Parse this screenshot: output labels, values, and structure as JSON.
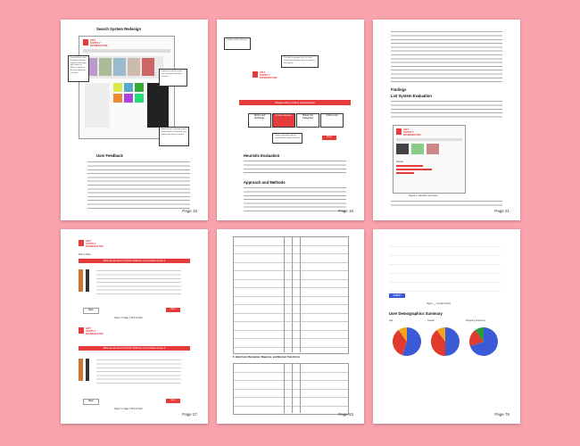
{
  "pages": [
    {
      "number": "Page 15",
      "title": "Search System Redesign",
      "section": "User Feedback",
      "callouts": [
        "Search Bar is now located at the top center of the page with same as above sentences for all, to the user can find",
        "Layout of search results are horizontal instead of vertical",
        "Most critical / relevant action feature that will help the user refine their search results"
      ]
    },
    {
      "number": "Page 16",
      "section1": "Heuristic Evaluation",
      "section2": "Approach and Methods",
      "banner": "Please add a email to unsubscribed",
      "flow_nodes": [
        "Pick-Up Store",
        "Return and Exchange",
        "Product Reviews",
        "Brand and Categories",
        "Artists Look",
        "Back",
        "Next"
      ],
      "flow_callouts": [
        "Visitors visible click box.",
        "Possible to program the list of the store based on the user's location in the system",
        "Option should be able to proceed with entire selection"
      ]
    },
    {
      "number": "Page 21",
      "section1": "Findings",
      "section2": "List System Evaluation",
      "stats_label": "Stores",
      "caption": "Figure 1: Heuristic summary"
    },
    {
      "number": "Page 27",
      "banner1": "Below are the items for Robert Robinson at your Please choose 2",
      "banner2": "Below are the items for Robert Robinson at your Please choose 2",
      "buttons": [
        "Back",
        "Next"
      ],
      "captions": [
        "Figure 4: Stage 1 Pick & Pack",
        "Figure 5: Stage 2 Pick & Pack"
      ],
      "header": "Pick & Pack"
    },
    {
      "number": "Page 53",
      "section": "5. Help Users Recognize, Diagnose, and Recover from Errors"
    },
    {
      "number": "Page 76",
      "section": "User Demographics Summary",
      "chart_labels": [
        "Age",
        "Gender",
        "Shopping Frequency"
      ],
      "submit": "SUBMIT",
      "figure_caption": "Figure __: Google Survey"
    }
  ],
  "brand": {
    "line1": "ART",
    "line2": "SUPPLY",
    "line3": "WAREHOUSE"
  },
  "chart_data": [
    {
      "type": "pie",
      "title": "Age",
      "values": [
        55,
        35,
        10
      ],
      "colors": [
        "#3b5bd6",
        "#e03a2f",
        "#f2a51a"
      ]
    },
    {
      "type": "pie",
      "title": "Gender",
      "values": [
        50,
        40,
        10
      ],
      "colors": [
        "#3b5bd6",
        "#e03a2f",
        "#f2a51a"
      ]
    },
    {
      "type": "pie",
      "title": "Shopping Frequency",
      "values": [
        70,
        20,
        10
      ],
      "colors": [
        "#3b5bd6",
        "#e03a2f",
        "#2a9d3b"
      ]
    }
  ]
}
